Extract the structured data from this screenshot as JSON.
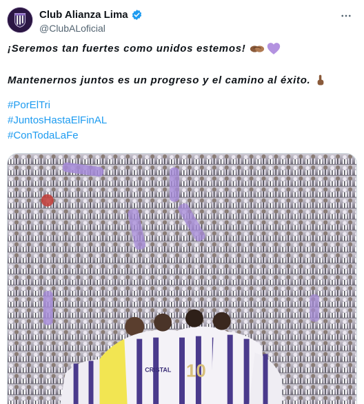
{
  "tweet": {
    "display_name": "Club Alianza Lima",
    "handle": "@ClubALoficial",
    "line1": "¡Seremos tan fuertes como unidos estemos!",
    "line1_emojis": [
      "handshake-icon",
      "purple-heart-icon"
    ],
    "line2": "Mantenernos juntos es un progreso y el camino al éxito.",
    "line2_emojis": [
      "pointing-up-icon"
    ],
    "hashtags": [
      "#PorElTri",
      "#JuntosHastaElFinAL",
      "#ConTodaLaFe"
    ],
    "media": {
      "description": "team-huddle-photo",
      "jersey_number": "10",
      "jersey_sponsor": "CRISTAL"
    }
  },
  "colors": {
    "hashtag": "#1d9bf0",
    "verified": "#1d9bf0",
    "handle": "#536471",
    "purple": "#8d6bc7"
  }
}
